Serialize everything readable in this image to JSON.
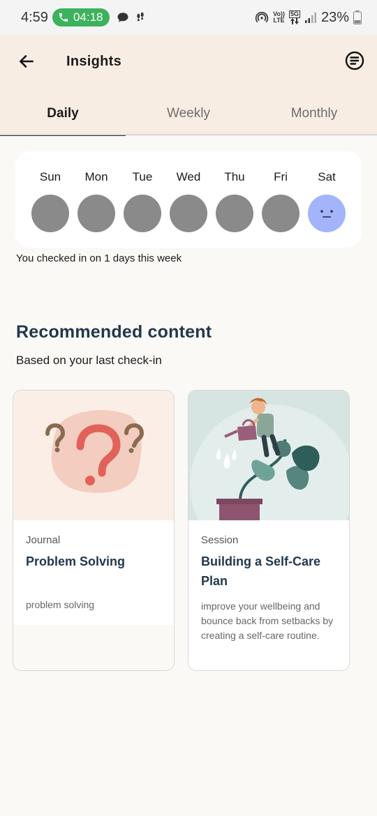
{
  "status_bar": {
    "time": "4:59",
    "call_timer": "04:18",
    "volte": "Vo))",
    "lte": "LTE",
    "network": "5G",
    "battery": "23%"
  },
  "header": {
    "title": "Insights"
  },
  "tabs": [
    {
      "label": "Daily",
      "active": true
    },
    {
      "label": "Weekly",
      "active": false
    },
    {
      "label": "Monthly",
      "active": false
    }
  ],
  "week": {
    "days": [
      "Sun",
      "Mon",
      "Tue",
      "Wed",
      "Thu",
      "Fri",
      "Sat"
    ],
    "checked_day": "Sat",
    "summary": "You checked in on 1 days this week"
  },
  "recommended": {
    "title": "Recommended content",
    "subtitle": "Based on your last check-in",
    "cards": [
      {
        "type": "Journal",
        "title": "Problem Solving",
        "description": "problem solving",
        "image_icon": "question-marks-illustration",
        "image_bg": "#fbeee7"
      },
      {
        "type": "Session",
        "title": "Building a Self-Care Plan",
        "description": "improve your wellbeing and bounce back from setbacks by creating a self-care routine.",
        "image_icon": "gardener-watering-plant-illustration",
        "image_bg": "#d6e4e2"
      }
    ]
  },
  "colors": {
    "header_bg": "#f7ede3",
    "accent": "#23384c",
    "checked_dot": "#a4b4fb",
    "empty_dot": "#8a8a8a"
  }
}
